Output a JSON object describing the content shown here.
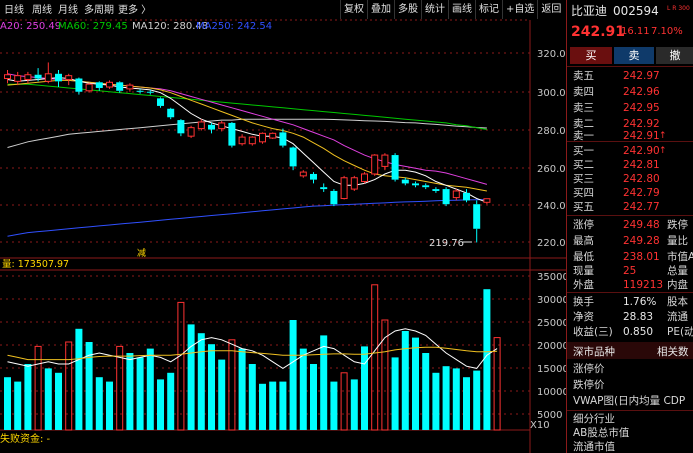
{
  "toolbar": {
    "fuquan": "复权",
    "diejia": "叠加",
    "duogu": "多股",
    "tongji": "统计",
    "huaxian": "画线",
    "biaoji": "标记",
    "zixuan": "+自选",
    "fanhui": "返回"
  },
  "period_tabs": [
    "日线",
    "周线",
    "月线",
    "多周期",
    "更多 〉"
  ],
  "ma_legend": {
    "ma20": "A20: 250.49",
    "ma60": "MA60: 279.45",
    "ma120": "MA120: 280.48",
    "ma250": "MA250: 242.54"
  },
  "colors": {
    "up": "#ff3232",
    "down": "#00ffff",
    "ma5": "#ffffff",
    "ma10": "#f0c020",
    "ma20": "#e040e0",
    "ma60": "#00c800",
    "ma120": "#d0d0d0",
    "ma250": "#3050ff",
    "grid": "#8b1a1a",
    "axis_text": "#c8c8c8",
    "vol_label": "#ffd700"
  },
  "chart_data": [
    {
      "type": "candlestick",
      "y_ticks": [
        "320.00",
        "300.00",
        "280.00",
        "260.00",
        "240.00",
        "220.00"
      ],
      "ylim": [
        213,
        330
      ],
      "low_annotation": "219.76",
      "event_marker": "减",
      "candles": [
        {
          "o": 306.5,
          "c": 308.5,
          "h": 311,
          "l": 304
        },
        {
          "o": 305,
          "c": 308,
          "h": 310,
          "l": 303
        },
        {
          "o": 306,
          "c": 308.5,
          "h": 310,
          "l": 304
        },
        {
          "o": 308.5,
          "c": 306.5,
          "h": 312,
          "l": 305
        },
        {
          "o": 305,
          "c": 309,
          "h": 315,
          "l": 304
        },
        {
          "o": 309,
          "c": 305,
          "h": 311,
          "l": 302
        },
        {
          "o": 306,
          "c": 308,
          "h": 309,
          "l": 303
        },
        {
          "o": 306.5,
          "c": 299.5,
          "h": 307,
          "l": 298
        },
        {
          "o": 300,
          "c": 303.5,
          "h": 304,
          "l": 299
        },
        {
          "o": 304.5,
          "c": 301.5,
          "h": 305,
          "l": 300
        },
        {
          "o": 302,
          "c": 304.5,
          "h": 305.5,
          "l": 301
        },
        {
          "o": 304.5,
          "c": 300,
          "h": 305,
          "l": 299
        },
        {
          "o": 301,
          "c": 303,
          "h": 304,
          "l": 299.5
        },
        {
          "o": 300,
          "c": 299.5,
          "h": 301,
          "l": 298.5
        },
        {
          "o": 299.5,
          "c": 299,
          "h": 300.5,
          "l": 298
        },
        {
          "o": 296,
          "c": 292,
          "h": 296.5,
          "l": 291
        },
        {
          "o": 290.5,
          "c": 286,
          "h": 291,
          "l": 285
        },
        {
          "o": 284.5,
          "c": 277.5,
          "h": 285,
          "l": 276
        },
        {
          "o": 276,
          "c": 280.5,
          "h": 281.5,
          "l": 275
        },
        {
          "o": 280,
          "c": 283.5,
          "h": 285,
          "l": 279
        },
        {
          "o": 282,
          "c": 279.5,
          "h": 283,
          "l": 277.5
        },
        {
          "o": 280,
          "c": 283,
          "h": 284,
          "l": 278.5
        },
        {
          "o": 283,
          "c": 271,
          "h": 283.5,
          "l": 270
        },
        {
          "o": 272,
          "c": 275.5,
          "h": 277,
          "l": 271
        },
        {
          "o": 272,
          "c": 275.5,
          "h": 276,
          "l": 271
        },
        {
          "o": 273,
          "c": 277.5,
          "h": 278,
          "l": 272
        },
        {
          "o": 275,
          "c": 277.5,
          "h": 278,
          "l": 274.5
        },
        {
          "o": 278,
          "c": 271,
          "h": 280,
          "l": 270
        },
        {
          "o": 270,
          "c": 260,
          "h": 270.5,
          "l": 258
        },
        {
          "o": 255,
          "c": 257,
          "h": 258,
          "l": 254
        },
        {
          "o": 256,
          "c": 253,
          "h": 257,
          "l": 251
        },
        {
          "o": 249,
          "c": 248,
          "h": 251,
          "l": 246.5
        },
        {
          "o": 247,
          "c": 240,
          "h": 248,
          "l": 239
        },
        {
          "o": 243,
          "c": 254,
          "h": 255,
          "l": 242.5
        },
        {
          "o": 248,
          "c": 254,
          "h": 255,
          "l": 247
        },
        {
          "o": 252,
          "c": 256,
          "h": 257,
          "l": 251
        },
        {
          "o": 256,
          "c": 266,
          "h": 266.5,
          "l": 255
        },
        {
          "o": 260,
          "c": 266,
          "h": 267,
          "l": 258
        },
        {
          "o": 266,
          "c": 253,
          "h": 267,
          "l": 252
        },
        {
          "o": 253,
          "c": 251,
          "h": 254,
          "l": 250
        },
        {
          "o": 251,
          "c": 250,
          "h": 252,
          "l": 249
        },
        {
          "o": 250,
          "c": 249,
          "h": 251,
          "l": 248
        },
        {
          "o": 248,
          "c": 247,
          "h": 249,
          "l": 246
        },
        {
          "o": 248,
          "c": 240,
          "h": 249,
          "l": 239
        },
        {
          "o": 243.5,
          "c": 247,
          "h": 248,
          "l": 242
        },
        {
          "o": 246,
          "c": 242,
          "h": 248,
          "l": 241
        },
        {
          "o": 240,
          "c": 227,
          "h": 242,
          "l": 219.76
        },
        {
          "o": 241,
          "c": 242.9,
          "h": 243,
          "l": 240
        }
      ],
      "ma_lines": {
        "ma5": [
          306,
          305,
          305.5,
          306,
          306.5,
          307,
          306.5,
          305,
          304,
          303.5,
          303,
          302,
          301.5,
          301,
          300.5,
          299,
          296,
          292,
          288,
          285,
          283,
          281.5,
          280,
          278.5,
          277,
          276,
          276,
          275,
          272,
          267,
          262,
          257,
          252,
          250,
          250,
          251,
          253,
          256,
          258,
          258,
          257,
          255,
          252,
          250,
          248,
          246,
          243,
          241
        ],
        "ma10": [
          303,
          303.5,
          304,
          304.5,
          305,
          305.5,
          305.5,
          305,
          304.5,
          304,
          303.5,
          303,
          302.5,
          302,
          301.5,
          300.5,
          299,
          297,
          295,
          293,
          291,
          289,
          287,
          285,
          283,
          281.5,
          280,
          279,
          277.5,
          275.5,
          272.5,
          269.5,
          266,
          263,
          260.5,
          258,
          256,
          255,
          254.5,
          254,
          253,
          252,
          251,
          250,
          249.5,
          249,
          248,
          247
        ],
        "ma20": [
          309,
          308,
          307.5,
          307,
          306.5,
          306,
          305.5,
          305,
          304.5,
          304,
          303.5,
          303,
          302.5,
          302,
          301.5,
          301,
          300,
          298.5,
          297,
          295.5,
          294,
          292.5,
          291,
          289.5,
          288,
          286.5,
          285,
          283.5,
          282,
          280,
          278,
          276,
          274,
          271,
          268.5,
          266,
          264,
          262.5,
          261,
          260,
          259,
          258,
          257.5,
          256.5,
          255,
          253.5,
          252,
          250.5
        ],
        "ma60": [
          303.5,
          303.5,
          303.5,
          303,
          302.5,
          302,
          301.5,
          301,
          300.5,
          300,
          299.5,
          299,
          298.5,
          298,
          297.5,
          297,
          296.5,
          296,
          295.5,
          295,
          294.5,
          294,
          293.5,
          293,
          292.5,
          292,
          291.5,
          291,
          290.5,
          290,
          289.5,
          289,
          288.5,
          288,
          287.5,
          287,
          286.5,
          286,
          285.5,
          285,
          284.5,
          284,
          283.5,
          283,
          282,
          281.5,
          280.5,
          279.5
        ],
        "ma120": [
          270,
          271.5,
          273,
          274,
          275,
          276,
          277,
          277.5,
          278,
          278.5,
          279,
          279.5,
          280,
          280.5,
          281,
          281.5,
          282,
          282.5,
          283,
          283.5,
          284,
          284.5,
          284.5,
          285,
          285,
          285,
          285,
          285,
          285,
          285,
          285,
          285,
          284.8,
          284.6,
          284.4,
          284.2,
          284,
          283.8,
          283.5,
          283.2,
          283,
          282.6,
          282.2,
          281.8,
          281.3,
          281,
          280.6,
          280.3
        ],
        "ma250": [
          223,
          224,
          225,
          225.5,
          226,
          226.5,
          227,
          227.5,
          228,
          228.5,
          229,
          229.5,
          230,
          230.5,
          231,
          231.5,
          232,
          232.5,
          233,
          233.5,
          234,
          234.5,
          235,
          235.5,
          236,
          236.5,
          237,
          237.5,
          238,
          238.5,
          239,
          239.2,
          239.5,
          239.8,
          240,
          240.2,
          240.5,
          240.7,
          241,
          241.2,
          241.4,
          241.6,
          241.8,
          242,
          242.1,
          242.3,
          242.4,
          242.5
        ]
      }
    },
    {
      "type": "bar",
      "label": "量: 173507.97",
      "y_ticks": [
        "35000",
        "30000",
        "25000",
        "20000",
        "15000",
        "10000",
        "5000"
      ],
      "y_unit": "X10",
      "ylim": [
        0,
        36000
      ],
      "values": [
        12000,
        11000,
        15000,
        19000,
        14000,
        13000,
        20000,
        23000,
        20000,
        12000,
        11000,
        19000,
        17500,
        16500,
        18500,
        11500,
        13000,
        29000,
        24000,
        22000,
        19500,
        16000,
        20500,
        18500,
        15000,
        10500,
        11000,
        11000,
        25000,
        18500,
        15000,
        21500,
        11000,
        13000,
        11500,
        19000,
        33000,
        25000,
        16500,
        22500,
        21000,
        17500,
        13000,
        14500,
        14000,
        12000,
        13500,
        32000,
        21000
      ],
      "up_flags": [
        0,
        0,
        0,
        1,
        0,
        0,
        1,
        0,
        0,
        0,
        0,
        1,
        0,
        0,
        0,
        0,
        0,
        1,
        0,
        0,
        0,
        0,
        1,
        0,
        0,
        0,
        0,
        0,
        0,
        0,
        0,
        0,
        0,
        1,
        0,
        0,
        1,
        1,
        0,
        0,
        0,
        0,
        0,
        0,
        0,
        0,
        0,
        0,
        1
      ],
      "ma_fast": [
        15500,
        15000,
        14500,
        15000,
        15500,
        15000,
        15000,
        16000,
        17000,
        17500,
        17000,
        16500,
        16000,
        16500,
        17000,
        16500,
        15500,
        17000,
        19000,
        20500,
        21000,
        20500,
        19500,
        18500,
        18000,
        17000,
        15500,
        14000,
        15500,
        17000,
        18000,
        19000,
        18500,
        17000,
        15500,
        15000,
        18000,
        21000,
        22500,
        23000,
        22500,
        21500,
        19500,
        17500,
        16000,
        14500,
        14000,
        17000,
        18500
      ],
      "ma_slow": [
        17000,
        16500,
        16000,
        16000,
        16000,
        16000,
        16000,
        16200,
        16500,
        16700,
        16800,
        16800,
        16800,
        16900,
        17000,
        17000,
        17000,
        17200,
        17500,
        17800,
        18000,
        18000,
        18000,
        17800,
        17600,
        17400,
        17200,
        17000,
        17000,
        17000,
        17100,
        17200,
        17300,
        17300,
        17200,
        17200,
        17500,
        17800,
        18200,
        18500,
        18700,
        18800,
        18800,
        18600,
        18300,
        18000,
        17800,
        17800,
        17900
      ]
    }
  ],
  "bottom_label": "失败资金: -",
  "quote": {
    "name": "比亚迪",
    "code": "002594",
    "price": "242.91",
    "change": "16.11",
    "pct": "7.10%",
    "lr": "L R 300",
    "buy_btn": "买",
    "sell_btn": "卖",
    "more_btn": "撤",
    "asks": [
      {
        "label": "卖五",
        "price": "242.97"
      },
      {
        "label": "卖四",
        "price": "242.96"
      },
      {
        "label": "卖三",
        "price": "242.95"
      },
      {
        "label": "卖二",
        "price": "242.92"
      },
      {
        "label": "卖一",
        "price": "242.91"
      }
    ],
    "bids": [
      {
        "label": "买一",
        "price": "242.90"
      },
      {
        "label": "买二",
        "price": "242.81"
      },
      {
        "label": "买三",
        "price": "242.80"
      },
      {
        "label": "买四",
        "price": "242.79"
      },
      {
        "label": "买五",
        "price": "242.77"
      }
    ],
    "stats": [
      {
        "label": "涨停",
        "value": "249.48",
        "label2": "跌停"
      },
      {
        "label": "最高",
        "value": "249.28",
        "label2": "量比"
      },
      {
        "label": "最低",
        "value": "238.01",
        "label2": "市值A"
      },
      {
        "label": "现量",
        "value": "25",
        "label2": "总量"
      },
      {
        "label": "外盘",
        "value": "119213",
        "label2": "内盘"
      },
      {
        "label": "换手",
        "value": "1.76%",
        "label2": "股本"
      },
      {
        "label": "净资",
        "value": "28.83",
        "label2": "流通"
      },
      {
        "label": "收益(三)",
        "value": "0.850",
        "label2": "PE(动"
      }
    ],
    "section_title": "深市品种",
    "section_right": "相关数",
    "extra_rows": [
      "涨停价",
      "跌停价",
      "VWAP图(日内均量 CDP"
    ],
    "bottom_rows": [
      "细分行业",
      "AB股总市值",
      "流通市值"
    ]
  }
}
